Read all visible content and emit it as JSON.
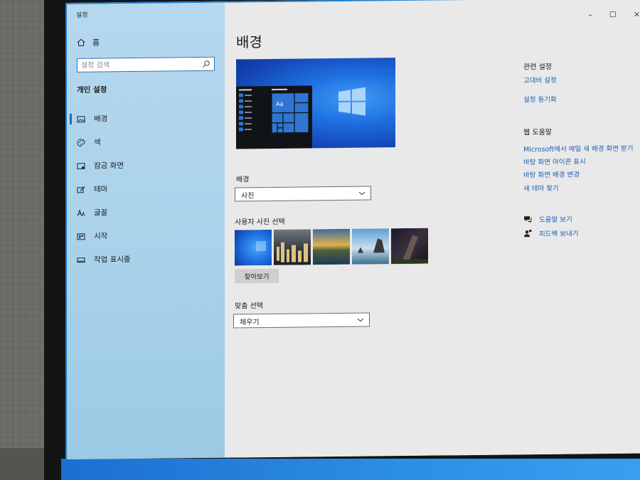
{
  "window": {
    "title": "설정",
    "minimize_glyph": "–",
    "maximize_glyph": "☐",
    "close_glyph": "×"
  },
  "sidebar": {
    "home_label": "홈",
    "search_placeholder": "설정 검색",
    "section_title": "개인 설정",
    "items": [
      {
        "label": "배경",
        "icon": "picture-icon",
        "active": true
      },
      {
        "label": "색",
        "icon": "palette-icon"
      },
      {
        "label": "잠금 화면",
        "icon": "lock-screen-icon"
      },
      {
        "label": "테마",
        "icon": "theme-brush-icon"
      },
      {
        "label": "글꼴",
        "icon": "font-icon"
      },
      {
        "label": "시작",
        "icon": "start-icon"
      },
      {
        "label": "작업 표시줄",
        "icon": "taskbar-icon"
      }
    ]
  },
  "main": {
    "page_title": "배경",
    "preview_sample_text": "Aa",
    "background_label": "배경",
    "background_value": "사진",
    "choose_picture_label": "사용자 사진 선택",
    "browse_button": "찾아보기",
    "fit_label": "맞춤 선택",
    "fit_value": "채우기"
  },
  "related": {
    "title": "관련 설정",
    "links": [
      "고대비 설정",
      "설정 동기화"
    ]
  },
  "web_help": {
    "title": "웹 도움말",
    "links": [
      "Microsoft에서 매일 새 배경 화면 받기",
      "바탕 화면 아이콘 표시",
      "바탕 화면 배경 변경",
      "새 테마 찾기"
    ]
  },
  "help": {
    "get_help": "도움말 보기",
    "feedback": "피드백 보내기"
  },
  "colors": {
    "accent": "#1f6fb5",
    "link": "#1a5fb4",
    "sidebar": "#b5d8ee"
  }
}
